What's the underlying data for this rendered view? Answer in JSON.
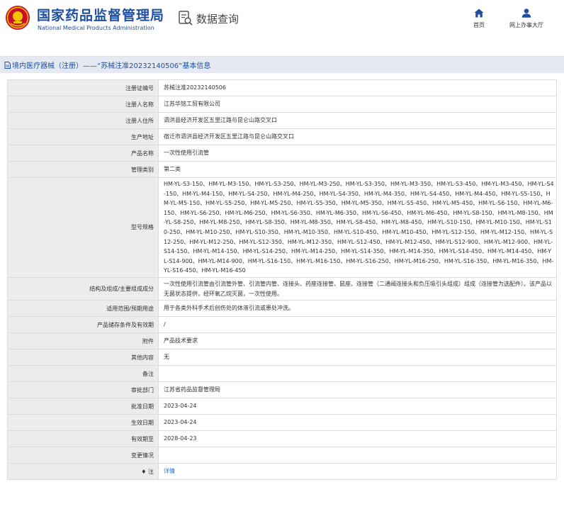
{
  "header": {
    "org_name_cn": "国家药品监督管理局",
    "org_name_en": "National Medical Products Administration",
    "query_label": "数据查询",
    "nav_home": "首页",
    "nav_online": "网上办事大厅",
    "icons": {
      "logo": "nmpa-emblem-icon",
      "query": "search-document-icon",
      "home": "home-icon",
      "online": "user-icon"
    },
    "brand_color": "#1e4fa1"
  },
  "titlebar": {
    "text": "境内医疗器械（注册）——“苏械注准20232140506”基本信息",
    "icon": "document-icon"
  },
  "rows": [
    {
      "label": "注册证编号",
      "value": "苏械注准20232140506"
    },
    {
      "label": "注册人名称",
      "value": "江苏华铭工贸有限公司"
    },
    {
      "label": "注册人住所",
      "value": "泗洪县经济开发区五里江路与昆仑山路交叉口"
    },
    {
      "label": "生产地址",
      "value": "宿迁市泗洪县经济开发区五里江路与昆仑山路交叉口"
    },
    {
      "label": "产品名称",
      "value": "一次性使用引流管"
    },
    {
      "label": "管理类别",
      "value": "第二类"
    },
    {
      "label": "型号规格",
      "value": "HM-YL-S3-150、HM-YL-M3-150、HM-YL-S3-250、HM-YL-M3-250、HM-YL-S3-350、HM-YL-M3-350、HM-YL-S3-450、HM-YL-M3-450、HM-YL-S4-150、HM-YL-M4-150、HM-YL-S4-250、HM-YL-M4-250、HM-YL-S4-350、HM-YL-M4-350、HM-YL-S4-450、HM-YL-M4-450、HM-YL-S5-150、HM-YL-M5-150、HM-YL-S5-250、HM-YL-M5-250、HM-YL-S5-350、HM-YL-M5-350、HM-YL-S5-450、HM-YL-M5-450、HM-YL-S6-150、HM-YL-M6-150、HM-YL-S6-250、HM-YL-M6-250、HM-YL-S6-350、HM-YL-M6-350、HM-YL-S6-450、HM-YL-M6-450、HM-YL-S8-150、HM-YL-M8-150、HM-YL-S8-250、HM-YL-M8-250、HM-YL-S8-350、HM-YL-M8-350、HM-YL-S8-450、HM-YL-M8-450、HM-YL-S10-150、HM-YL-M10-150、HM-YL-S10-250、HM-YL-M10-250、HM-YL-S10-350、HM-YL-M10-350、HM-YL-S10-450、HM-YL-M10-450、HM-YL-S12-150、HM-YL-M12-150、HM-YL-S12-250、HM-YL-M12-250、HM-YL-S12-350、HM-YL-M12-350、HM-YL-S12-450、HM-YL-M12-450、HM-YL-S12-900、HM-YL-M12-900、HM-YL-S14-150、HM-YL-M14-150、HM-YL-S14-250、HM-YL-M14-250、HM-YL-S14-350、HM-YL-M14-350、HM-YL-S14-450、HM-YL-M14-450、HM-YL-S14-900、HM-YL-M14-900、HM-YL-S16-150、HM-YL-M16-150、HM-YL-S16-250、HM-YL-M16-250、HM-YL-S16-350、HM-YL-M16-350、HM-YL-S16-450、HM-YL-M16-450"
    },
    {
      "label": "结构及组成/主要组成成分",
      "value": "一次性使用引流管由引流管外管、引流管内管、连接头、药座连接管、鼠座、连接管（二通阀连接头和负压吸引头组成）组成（连接管为选配件）。该产品以无菌状态提供，经环氧乙烷灭菌，一次性使用。"
    },
    {
      "label": "适用范围/预期用途",
      "value": "用于各类外科手术后创伤处的体液引流或患处冲洗。"
    },
    {
      "label": "产品储存条件及有效期",
      "value": "/"
    },
    {
      "label": "附件",
      "value": "产品技术要求"
    },
    {
      "label": "其他内容",
      "value": "无"
    },
    {
      "label": "备注",
      "value": ""
    },
    {
      "label": "审批部门",
      "value": "江苏省药品监督管理局"
    },
    {
      "label": "批准日期",
      "value": "2023-04-24"
    },
    {
      "label": "生效日期",
      "value": "2023-04-24"
    },
    {
      "label": "有效期至",
      "value": "2028-04-23"
    },
    {
      "label": "变更情况",
      "value": ""
    },
    {
      "label": "注",
      "value": "详情",
      "label_icon": "pin-icon"
    }
  ]
}
